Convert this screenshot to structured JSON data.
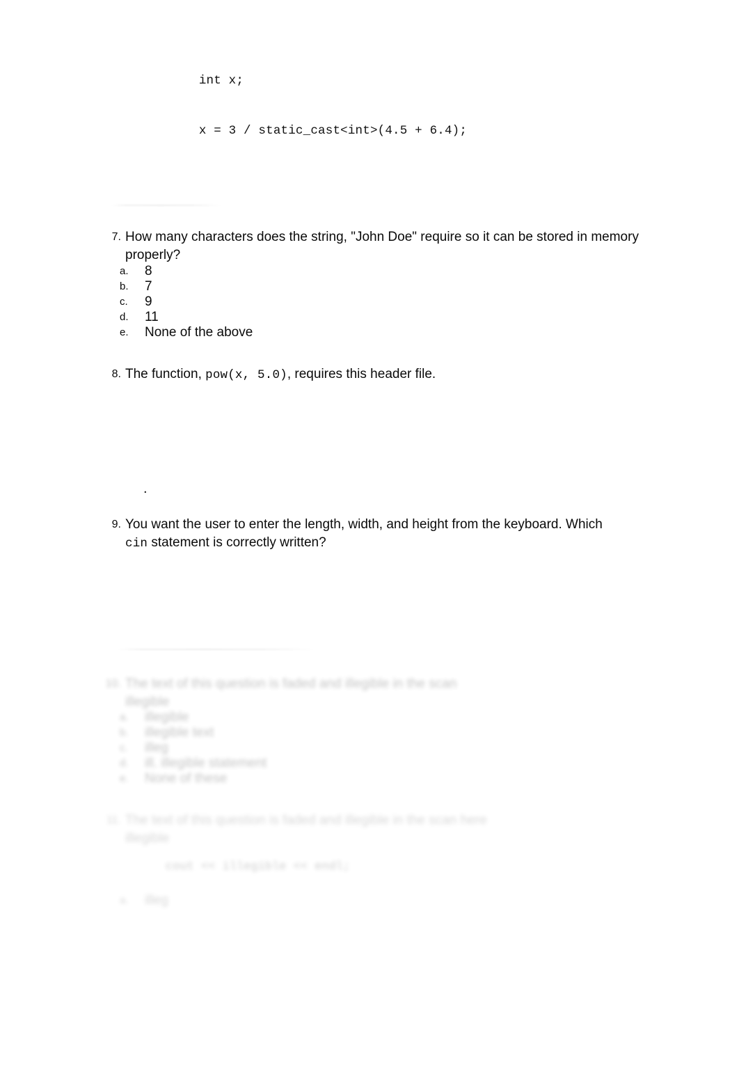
{
  "document": {
    "kind": "multiple-choice-quiz-page",
    "background_color": "#ffffff",
    "text_color": "#0a0a0a"
  },
  "code_snippet": {
    "line1": "int x;",
    "line2": "x = 3 / static_cast<int>(4.5 + 6.4);"
  },
  "stray_period": ".",
  "questions": [
    {
      "number": "7.",
      "text_line1": "How many characters does the string, \"John Doe\" require so it can be stored in memory",
      "text_line2": "properly?",
      "options": [
        {
          "letter": "a.",
          "text": "8"
        },
        {
          "letter": "b.",
          "text": "7"
        },
        {
          "letter": "c.",
          "text": "9"
        },
        {
          "letter": "d.",
          "text": "11"
        },
        {
          "letter": "e.",
          "text": "None of the above"
        }
      ]
    },
    {
      "number": "8.",
      "text_before_code": "The function, ",
      "code": "pow(x, 5.0)",
      "text_after_code": ", requires this header file.",
      "options": []
    },
    {
      "number": "9.",
      "text_line1": "You want the user to enter the length, width, and height from the keyboard. Which",
      "code": "cin",
      "text_line2_after_code": " statement is correctly written?",
      "options": []
    },
    {
      "number": "10.",
      "text_line1": "The text of this question is faded and illegible in the scan",
      "text_line2": "illegible",
      "illegible": true,
      "options": [
        {
          "letter": "a.",
          "text": "illegible"
        },
        {
          "letter": "b.",
          "text": "illegible text"
        },
        {
          "letter": "c.",
          "text": "illeg"
        },
        {
          "letter": "d.",
          "text": "ill. illegible statement"
        },
        {
          "letter": "e.",
          "text": "None of these"
        }
      ]
    },
    {
      "number": "11.",
      "text_line1": "The text of this question is faded and illegible in the scan here",
      "text_line2": "illegible",
      "illegible": true,
      "code": "cout << illegible << endl;",
      "options": [
        {
          "letter": "a.",
          "text": "illeg"
        }
      ]
    }
  ]
}
